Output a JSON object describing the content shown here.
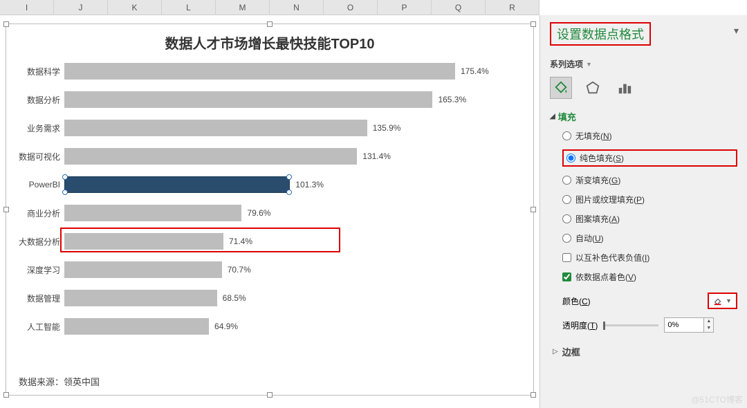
{
  "columns": [
    "I",
    "J",
    "K",
    "L",
    "M",
    "N",
    "O",
    "P",
    "Q",
    "R"
  ],
  "chart_data": {
    "type": "bar",
    "title": "数据人才市场增长最快技能TOP10",
    "categories": [
      "数据科学",
      "数据分析",
      "业务需求",
      "数据可视化",
      "PowerBI",
      "商业分析",
      "大数据分析",
      "深度学习",
      "数据管理",
      "人工智能"
    ],
    "values": [
      175.4,
      165.3,
      135.9,
      131.4,
      101.3,
      79.6,
      71.4,
      70.7,
      68.5,
      64.9
    ],
    "highlighted_index": 4,
    "xlabel": "",
    "ylabel": "",
    "value_suffix": "%",
    "source": "数据来源：领英中国"
  },
  "panel": {
    "title": "设置数据点格式",
    "series_options": "系列选项",
    "fill_section": "填充",
    "fill_options": {
      "none": "无填充(N)",
      "solid": "纯色填充(S)",
      "gradient": "渐变填充(G)",
      "picture": "图片或纹理填充(P)",
      "pattern": "图案填充(A)",
      "auto": "自动(U)"
    },
    "selected_fill": "solid",
    "invert_negative": "以互补色代表负值(I)",
    "invert_checked": false,
    "vary_by_point": "依数据点着色(V)",
    "vary_checked": true,
    "color_label": "颜色(C)",
    "transparency_label": "透明度(T)",
    "transparency_value": "0%",
    "border_section": "边框"
  },
  "watermark": "@51CTO博客"
}
